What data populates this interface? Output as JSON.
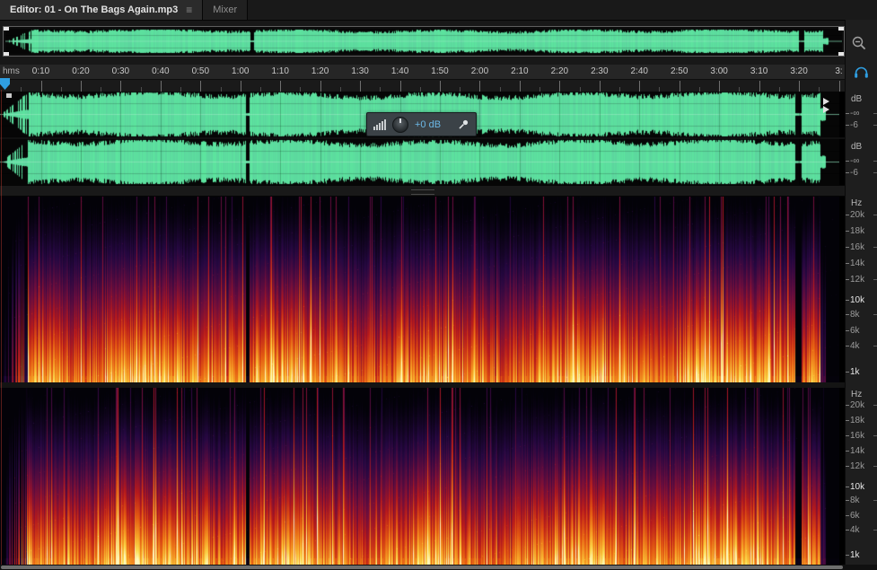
{
  "tabs": {
    "editor": "Editor: 01 - On The Bags Again.mp3",
    "mixer": "Mixer",
    "menu_glyph": "≡"
  },
  "timeline": {
    "unit": "hms",
    "labels": [
      "0:10",
      "0:20",
      "0:30",
      "0:40",
      "0:50",
      "1:00",
      "1:10",
      "1:20",
      "1:30",
      "1:40",
      "1:50",
      "2:00",
      "2:10",
      "2:20",
      "2:30",
      "2:40",
      "2:50",
      "3:00",
      "3:10",
      "3:20",
      "3:"
    ]
  },
  "hud": {
    "gain": "+0 dB"
  },
  "wave_scale": {
    "unit": "dB",
    "ticks": [
      "-∞",
      "-6"
    ]
  },
  "spec_scale": {
    "unit": "Hz",
    "ticks": [
      "20k",
      "18k",
      "16k",
      "14k",
      "12k",
      "10k",
      "8k",
      "6k",
      "4k",
      "1k"
    ],
    "bright": [
      "10k",
      "1k"
    ]
  },
  "colors": {
    "waveform_green": "#5ce0a1",
    "accent_blue": "#2f9fe2",
    "hud_value_blue": "#6cb8e6"
  }
}
